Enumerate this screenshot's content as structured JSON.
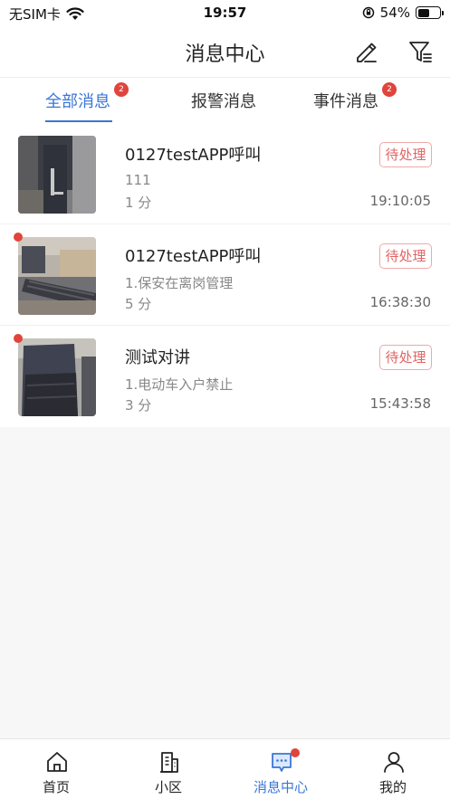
{
  "status_bar": {
    "carrier": "无SIM卡",
    "time": "19:57",
    "battery": "54%",
    "battery_level": 0.54
  },
  "header": {
    "title": "消息中心",
    "icons": [
      "edit-icon",
      "filter-icon"
    ]
  },
  "tabs": [
    {
      "label": "全部消息",
      "badge": "2",
      "active": true
    },
    {
      "label": "报警消息",
      "badge": "",
      "active": false
    },
    {
      "label": "事件消息",
      "badge": "2",
      "active": false
    }
  ],
  "messages": [
    {
      "title": "0127testAPP呼叫",
      "subtitle": "111",
      "duration": "1 分",
      "status": "待处理",
      "time": "19:10:05",
      "unread": false
    },
    {
      "title": "0127testAPP呼叫",
      "subtitle": "1.保安在离岗管理",
      "duration": "5 分",
      "status": "待处理",
      "time": "16:38:30",
      "unread": true
    },
    {
      "title": "测试对讲",
      "subtitle": "1.电动车入户禁止",
      "duration": "3 分",
      "status": "待处理",
      "time": "15:43:58",
      "unread": true
    }
  ],
  "tabbar": [
    {
      "label": "首页",
      "icon": "home-icon",
      "active": false
    },
    {
      "label": "小区",
      "icon": "building-icon",
      "active": false
    },
    {
      "label": "消息中心",
      "icon": "message-icon",
      "active": true
    },
    {
      "label": "我的",
      "icon": "user-icon",
      "active": false
    }
  ],
  "colors": {
    "accent": "#3b76d6",
    "badge": "#e0443b",
    "status": "#e06464"
  }
}
